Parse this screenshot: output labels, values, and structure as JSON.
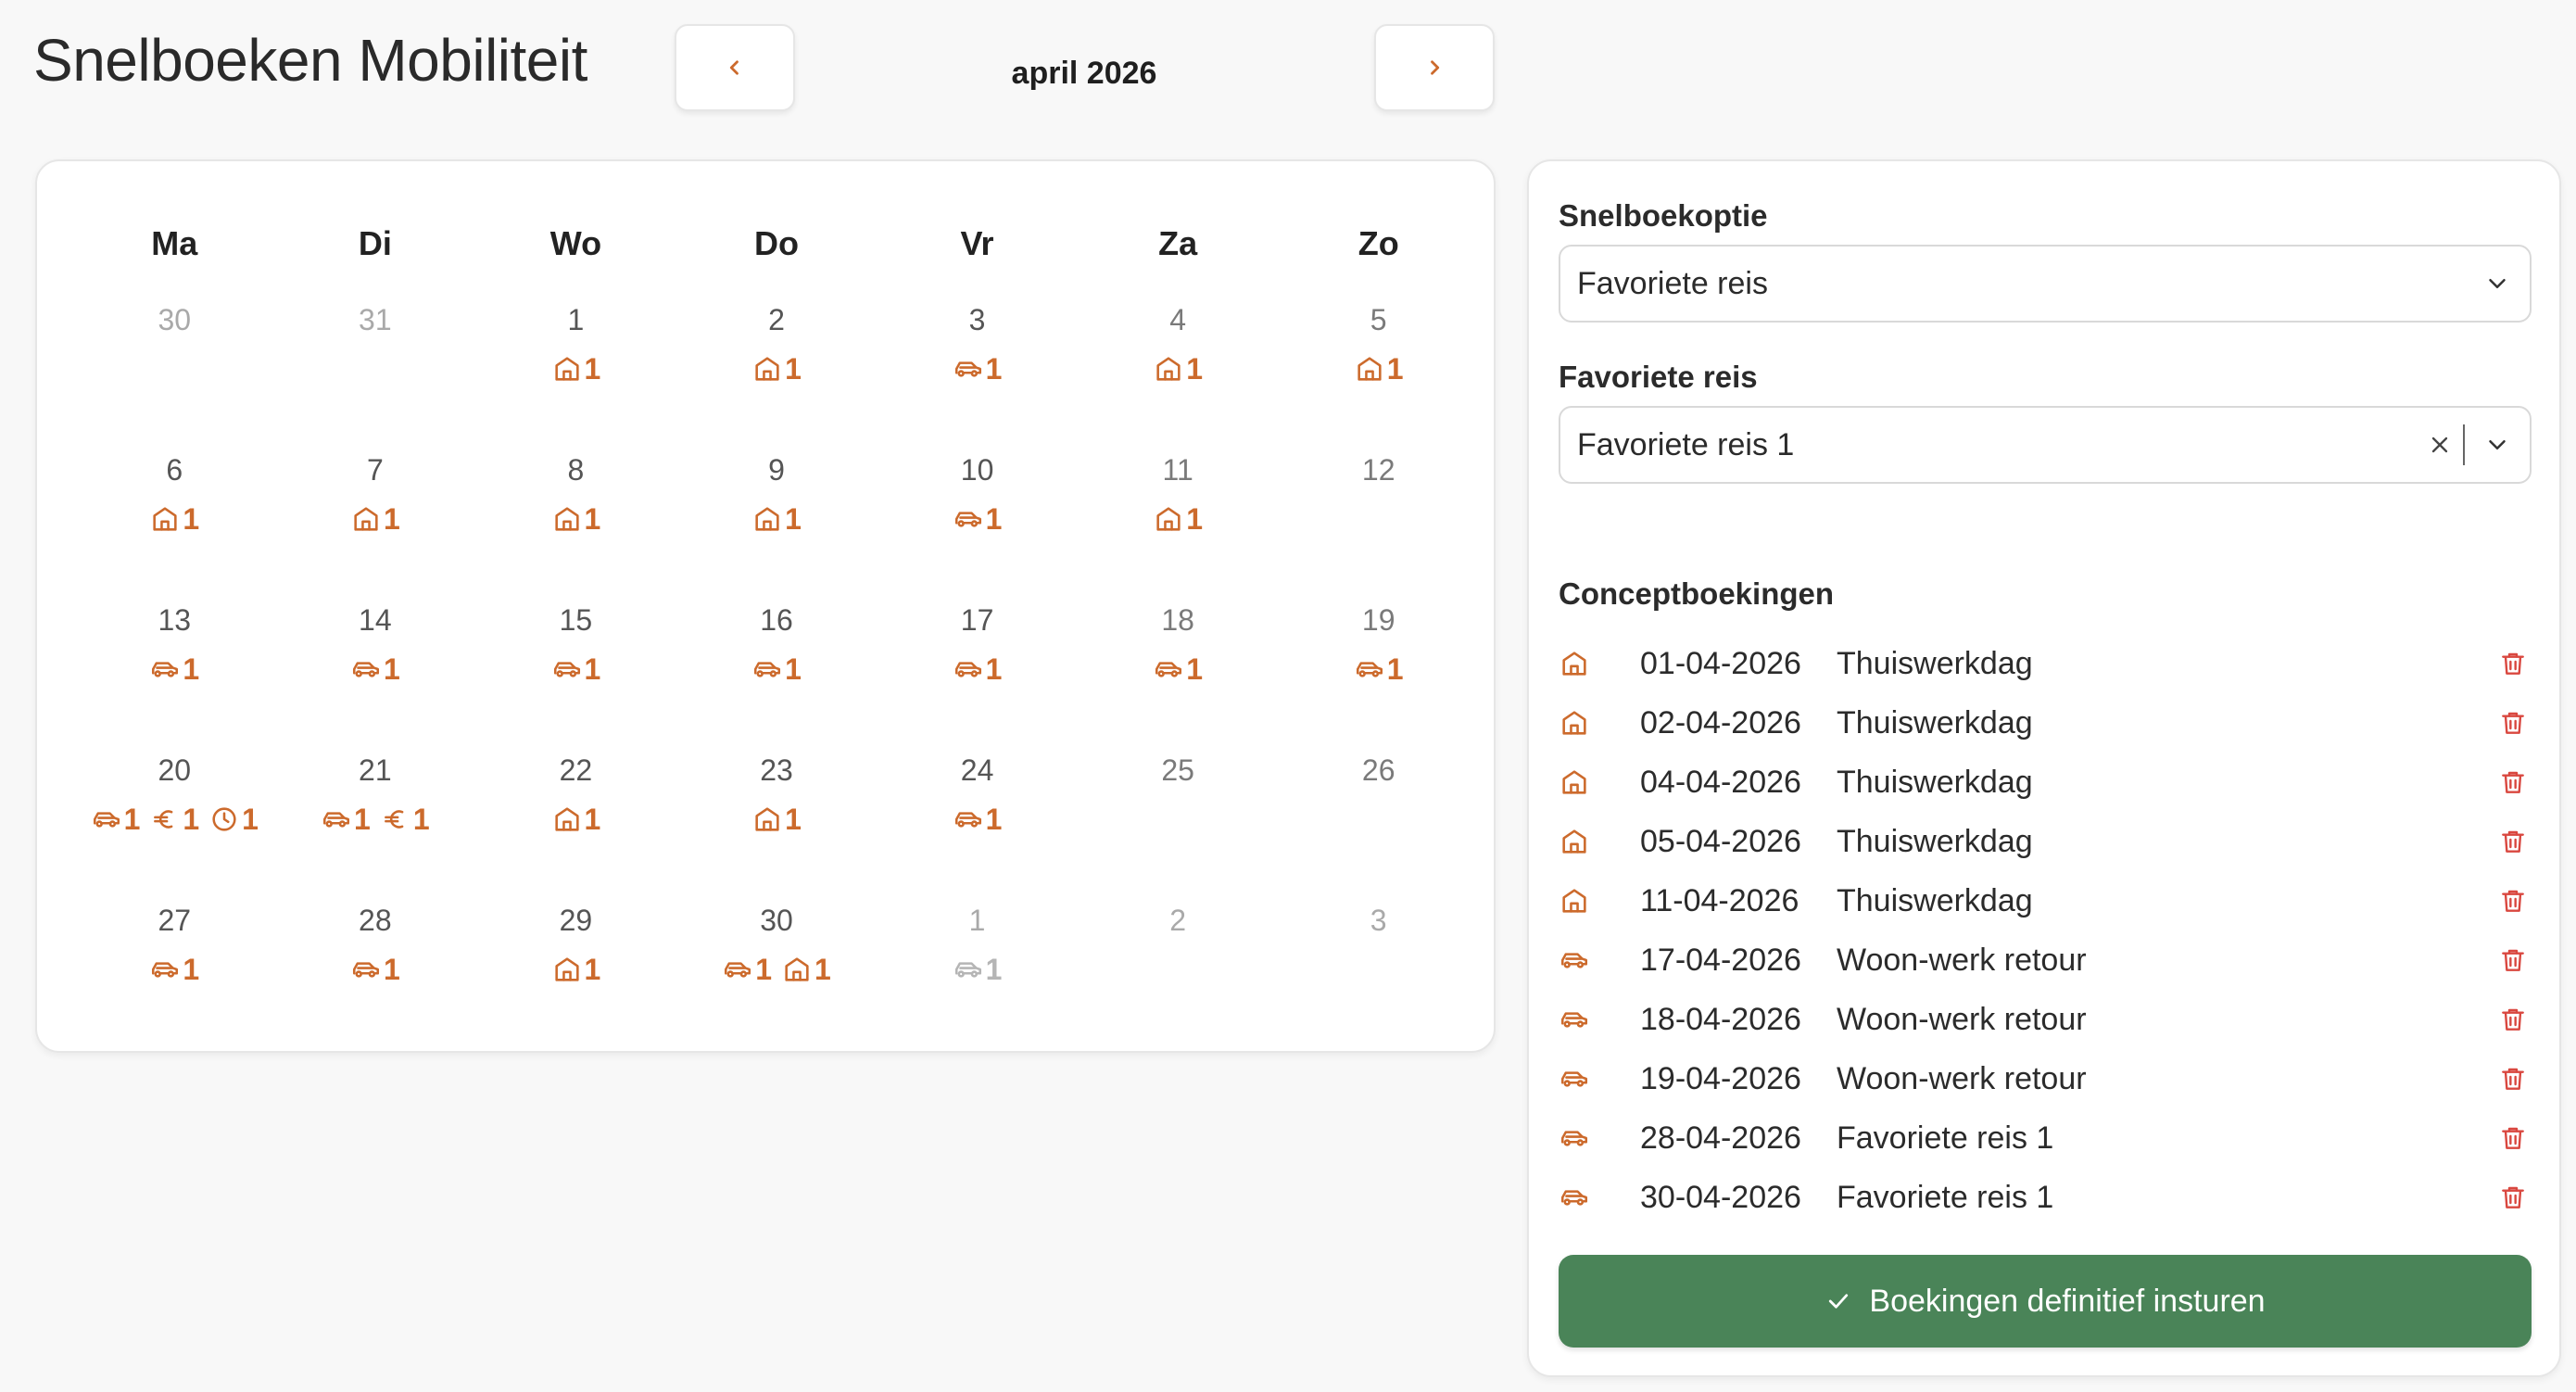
{
  "header": {
    "title": "Snelboeken Mobiliteit",
    "month": "april 2026"
  },
  "colors": {
    "accent": "#cc6a2c",
    "submit": "#4a8458",
    "delete": "#d9473f"
  },
  "calendar": {
    "weekdays": [
      "Ma",
      "Di",
      "Wo",
      "Do",
      "Vr",
      "Za",
      "Zo"
    ],
    "weeks": [
      [
        {
          "day": "30",
          "muted": true,
          "badges": []
        },
        {
          "day": "31",
          "muted": true,
          "badges": []
        },
        {
          "day": "1",
          "badges": [
            {
              "icon": "home-icon",
              "count": "1"
            }
          ]
        },
        {
          "day": "2",
          "badges": [
            {
              "icon": "home-icon",
              "count": "1"
            }
          ]
        },
        {
          "day": "3",
          "badges": [
            {
              "icon": "car-icon",
              "count": "1"
            }
          ]
        },
        {
          "day": "4",
          "weekend": true,
          "badges": [
            {
              "icon": "home-icon",
              "count": "1"
            }
          ]
        },
        {
          "day": "5",
          "weekend": true,
          "badges": [
            {
              "icon": "home-icon",
              "count": "1"
            }
          ]
        }
      ],
      [
        {
          "day": "6",
          "badges": [
            {
              "icon": "home-icon",
              "count": "1"
            }
          ]
        },
        {
          "day": "7",
          "badges": [
            {
              "icon": "home-icon",
              "count": "1"
            }
          ]
        },
        {
          "day": "8",
          "badges": [
            {
              "icon": "home-icon",
              "count": "1"
            }
          ]
        },
        {
          "day": "9",
          "badges": [
            {
              "icon": "home-icon",
              "count": "1"
            }
          ]
        },
        {
          "day": "10",
          "badges": [
            {
              "icon": "car-icon",
              "count": "1"
            }
          ]
        },
        {
          "day": "11",
          "weekend": true,
          "badges": [
            {
              "icon": "home-icon",
              "count": "1"
            }
          ]
        },
        {
          "day": "12",
          "weekend": true,
          "badges": []
        }
      ],
      [
        {
          "day": "13",
          "badges": [
            {
              "icon": "car-icon",
              "count": "1"
            }
          ]
        },
        {
          "day": "14",
          "badges": [
            {
              "icon": "car-icon",
              "count": "1"
            }
          ]
        },
        {
          "day": "15",
          "badges": [
            {
              "icon": "car-icon",
              "count": "1"
            }
          ]
        },
        {
          "day": "16",
          "badges": [
            {
              "icon": "car-icon",
              "count": "1"
            }
          ]
        },
        {
          "day": "17",
          "badges": [
            {
              "icon": "car-icon",
              "count": "1"
            }
          ]
        },
        {
          "day": "18",
          "weekend": true,
          "badges": [
            {
              "icon": "car-icon",
              "count": "1"
            }
          ]
        },
        {
          "day": "19",
          "weekend": true,
          "badges": [
            {
              "icon": "car-icon",
              "count": "1"
            }
          ]
        }
      ],
      [
        {
          "day": "20",
          "badges": [
            {
              "icon": "car-icon",
              "count": "1"
            },
            {
              "icon": "euro-icon",
              "count": "1"
            },
            {
              "icon": "clock-icon",
              "count": "1"
            }
          ]
        },
        {
          "day": "21",
          "badges": [
            {
              "icon": "car-icon",
              "count": "1"
            },
            {
              "icon": "euro-icon",
              "count": "1"
            }
          ]
        },
        {
          "day": "22",
          "badges": [
            {
              "icon": "home-icon",
              "count": "1"
            }
          ]
        },
        {
          "day": "23",
          "badges": [
            {
              "icon": "home-icon",
              "count": "1"
            }
          ]
        },
        {
          "day": "24",
          "badges": [
            {
              "icon": "car-icon",
              "count": "1"
            }
          ]
        },
        {
          "day": "25",
          "weekend": true,
          "badges": []
        },
        {
          "day": "26",
          "weekend": true,
          "badges": []
        }
      ],
      [
        {
          "day": "27",
          "badges": [
            {
              "icon": "car-icon",
              "count": "1"
            }
          ]
        },
        {
          "day": "28",
          "badges": [
            {
              "icon": "car-icon",
              "count": "1"
            }
          ]
        },
        {
          "day": "29",
          "badges": [
            {
              "icon": "home-icon",
              "count": "1"
            }
          ]
        },
        {
          "day": "30",
          "badges": [
            {
              "icon": "car-icon",
              "count": "1"
            },
            {
              "icon": "home-icon",
              "count": "1"
            }
          ]
        },
        {
          "day": "1",
          "muted": true,
          "badges": [
            {
              "icon": "car-icon",
              "count": "1",
              "muted": true
            }
          ]
        },
        {
          "day": "2",
          "muted": true,
          "badges": []
        },
        {
          "day": "3",
          "muted": true,
          "badges": []
        }
      ]
    ]
  },
  "side": {
    "option_label": "Snelboekoptie",
    "option_value": "Favoriete reis",
    "favorite_label": "Favoriete reis",
    "favorite_value": "Favoriete reis 1",
    "concepts_label": "Conceptboekingen",
    "concepts": [
      {
        "icon": "home-icon",
        "date": "01-04-2026",
        "desc": "Thuiswerkdag"
      },
      {
        "icon": "home-icon",
        "date": "02-04-2026",
        "desc": "Thuiswerkdag"
      },
      {
        "icon": "home-icon",
        "date": "04-04-2026",
        "desc": "Thuiswerkdag"
      },
      {
        "icon": "home-icon",
        "date": "05-04-2026",
        "desc": "Thuiswerkdag"
      },
      {
        "icon": "home-icon",
        "date": "11-04-2026",
        "desc": "Thuiswerkdag"
      },
      {
        "icon": "car-icon",
        "date": "17-04-2026",
        "desc": "Woon-werk retour"
      },
      {
        "icon": "car-icon",
        "date": "18-04-2026",
        "desc": "Woon-werk retour"
      },
      {
        "icon": "car-icon",
        "date": "19-04-2026",
        "desc": "Woon-werk retour"
      },
      {
        "icon": "car-icon",
        "date": "28-04-2026",
        "desc": "Favoriete reis 1"
      },
      {
        "icon": "car-icon",
        "date": "30-04-2026",
        "desc": "Favoriete reis 1"
      }
    ],
    "submit_label": "Boekingen definitief insturen"
  }
}
